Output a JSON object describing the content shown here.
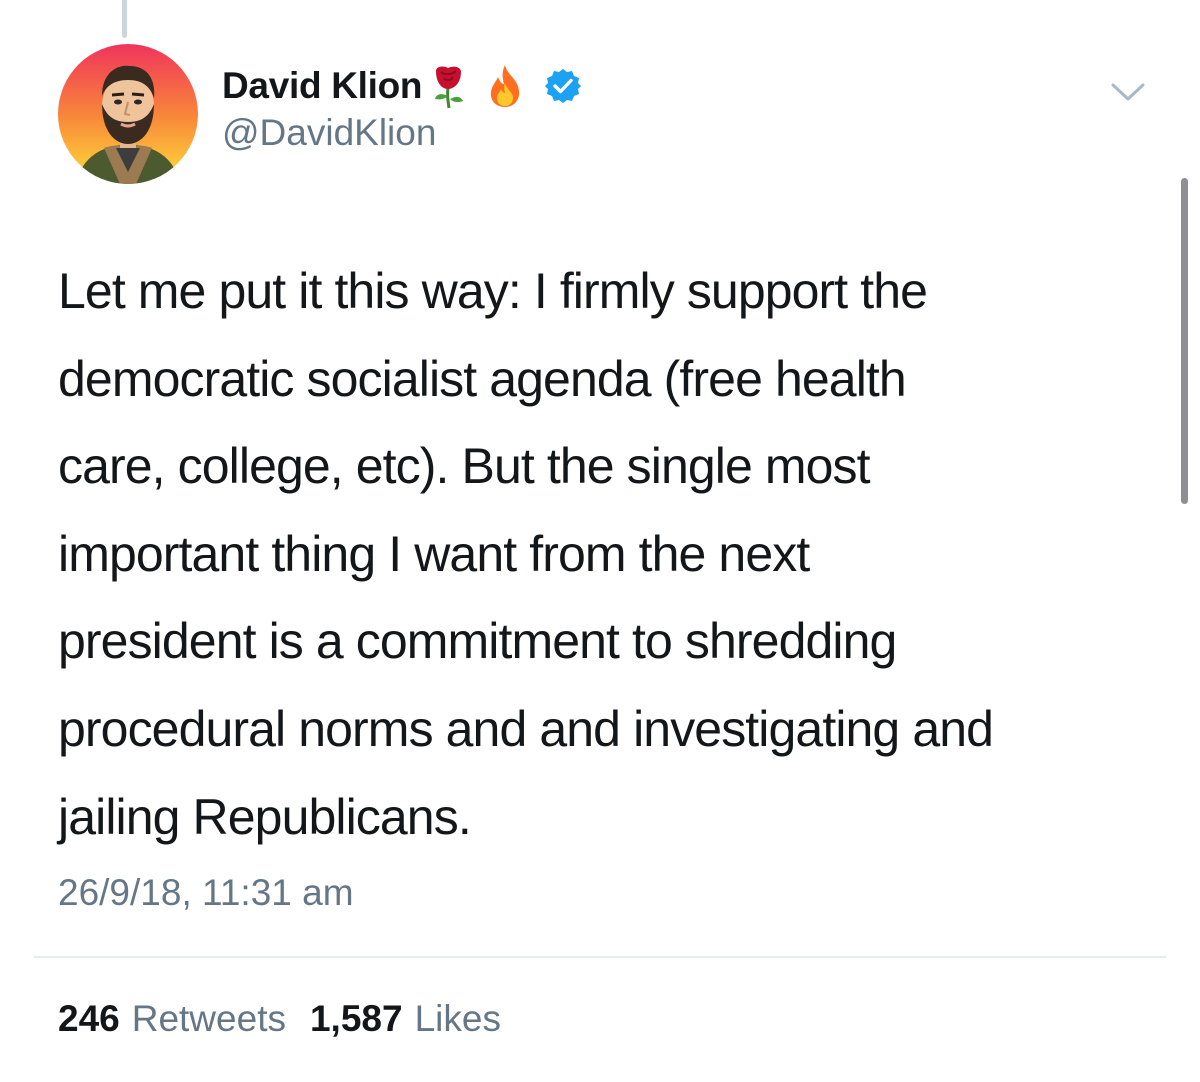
{
  "tweet": {
    "author": {
      "display_name": "David Klion",
      "name_emojis": [
        "rose-icon",
        "fire-icon"
      ],
      "verified": true,
      "verified_icon": "verified-badge-icon",
      "handle": "@DavidKlion",
      "avatar_icon": "avatar"
    },
    "menu_icon": "chevron-down-icon",
    "text_lines": [
      "Let me put it this way: I firmly support the",
      "democratic socialist agenda (free health",
      "care, college, etc). But the single most",
      "important thing I want from the next",
      "president is a commitment to shredding",
      "procedural norms and and investigating and",
      "jailing Republicans."
    ],
    "timestamp": "26/9/18, 11:31 am",
    "stats": {
      "retweets_count": "246",
      "retweets_label": "Retweets",
      "likes_count": "1,587",
      "likes_label": "Likes"
    }
  },
  "colors": {
    "text_primary": "#14171a",
    "text_secondary": "#657786",
    "verified_blue": "#1da1f2",
    "divider": "#e6ecf0"
  }
}
